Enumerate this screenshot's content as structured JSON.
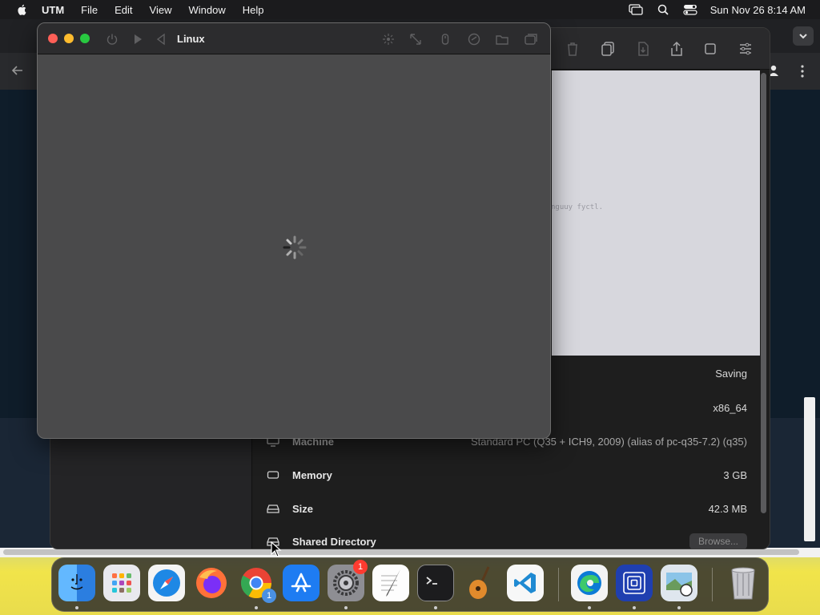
{
  "menubar": {
    "app_name": "UTM",
    "items": [
      "File",
      "Edit",
      "View",
      "Window",
      "Help"
    ],
    "clock": "Sun Nov 26  8:14 AM"
  },
  "vm_window": {
    "title": "Linux",
    "state": "loading"
  },
  "preview": {
    "text": "nguuy fyctl."
  },
  "details": {
    "status_value": "Saving",
    "arch_value": "x86_64",
    "machine_label": "Machine",
    "machine_value": "Standard PC (Q35 + ICH9, 2009) (alias of pc-q35-7.2) (q35)",
    "memory_label": "Memory",
    "memory_value": "3 GB",
    "size_label": "Size",
    "size_value": "42.3 MB",
    "shared_label": "Shared Directory",
    "browse_label": "Browse..."
  },
  "dock": {
    "items": [
      "Finder",
      "Launchpad",
      "Safari",
      "Firefox",
      "Google Chrome",
      "App Store",
      "System Settings",
      "TextEdit",
      "Terminal",
      "GarageBand",
      "Visual Studio Code",
      "Microsoft Edge",
      "UTM",
      "Preview",
      "Trash"
    ],
    "chrome_badge": "1",
    "settings_badge": "1"
  },
  "colors": {
    "traffic_red": "#fe5f57",
    "traffic_yellow": "#febc2e",
    "traffic_green": "#28c840",
    "badge": "#ff3b30"
  }
}
